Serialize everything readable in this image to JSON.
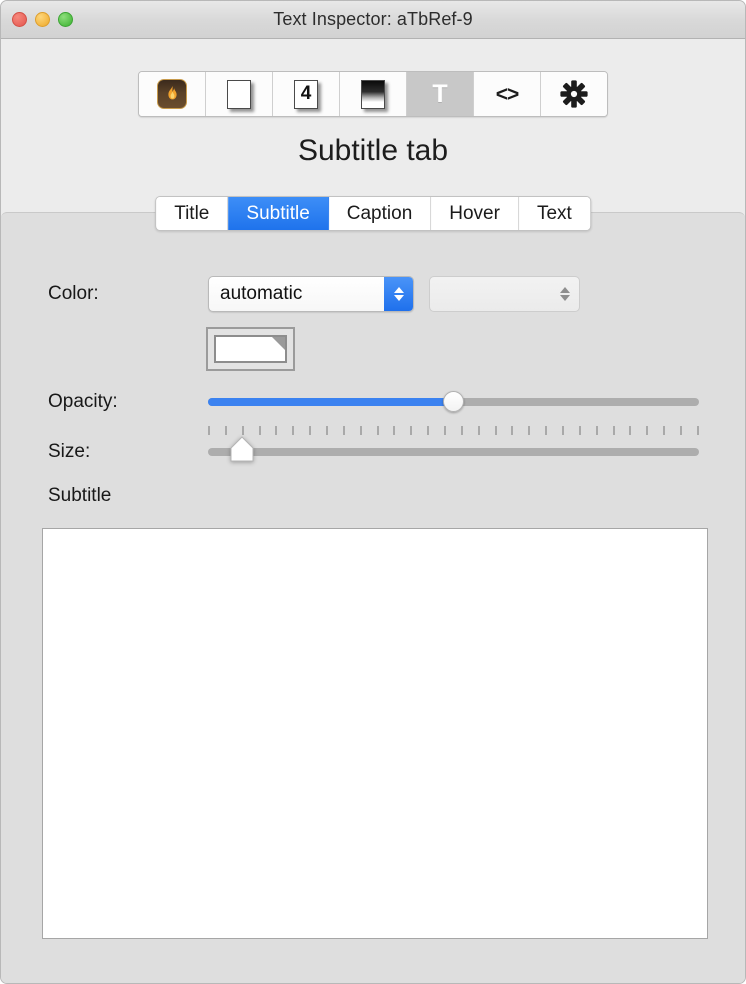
{
  "window": {
    "title": "Text Inspector: aTbRef-9",
    "traffic_lights": [
      {
        "name": "close",
        "color": "#ED6A5E"
      },
      {
        "name": "minimize",
        "color": "#F6BE4F"
      },
      {
        "name": "maximize",
        "color": "#61C454"
      }
    ]
  },
  "toolbar": {
    "items": [
      {
        "icon": "flame-icon",
        "label": "",
        "selected": false
      },
      {
        "icon": "blank-page-icon",
        "label": "",
        "selected": false
      },
      {
        "icon": "numbered-page-icon",
        "label": "4",
        "selected": false
      },
      {
        "icon": "gradient-page-icon",
        "label": "",
        "selected": false
      },
      {
        "icon": "text-T-icon",
        "label": "T",
        "selected": true
      },
      {
        "icon": "code-brackets-icon",
        "label": "<>",
        "selected": false
      },
      {
        "icon": "gear-icon",
        "label": "",
        "selected": false
      }
    ]
  },
  "pane": {
    "heading": "Subtitle tab"
  },
  "tabs": [
    {
      "label": "Title",
      "active": false
    },
    {
      "label": "Subtitle",
      "active": true
    },
    {
      "label": "Caption",
      "active": false
    },
    {
      "label": "Hover",
      "active": false
    },
    {
      "label": "Text",
      "active": false
    }
  ],
  "form": {
    "color": {
      "label": "Color:",
      "popup_value": "automatic",
      "secondary_popup_value": "",
      "color_well_value": "#FFFFFF"
    },
    "opacity": {
      "label": "Opacity:",
      "percent": 50
    },
    "size": {
      "label": "Size:",
      "percent": 7,
      "tick_count": 30
    },
    "subtitle": {
      "label": "Subtitle",
      "text": ""
    }
  },
  "colors": {
    "accent_blue": "#2F7BEE",
    "window_bg": "#ECECEC",
    "panel_bg": "#DEDEDE",
    "track_gray": "#ADADAD"
  }
}
